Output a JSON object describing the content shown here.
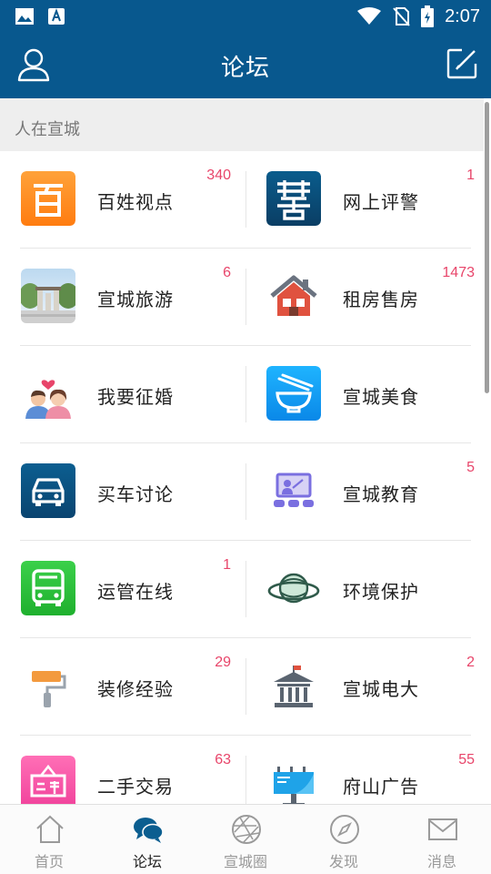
{
  "status_bar": {
    "time": "2:07",
    "icons": [
      "image-icon",
      "keyboard-a-icon",
      "wifi-icon",
      "no-sim-icon",
      "battery-icon"
    ]
  },
  "header": {
    "title": "论坛",
    "left_icon": "user-icon",
    "right_icon": "edit-icon"
  },
  "section": {
    "title": "人在宣城"
  },
  "forums": [
    {
      "left": {
        "label": "百姓视点",
        "count": "340",
        "icon": "baixing-icon"
      },
      "right": {
        "label": "网上评警",
        "count": "1",
        "icon": "police-icon"
      }
    },
    {
      "left": {
        "label": "宣城旅游",
        "count": "6",
        "icon": "travel-photo-icon"
      },
      "right": {
        "label": "租房售房",
        "count": "1473",
        "icon": "house-icon"
      }
    },
    {
      "left": {
        "label": "我要征婚",
        "count": "",
        "icon": "couple-icon"
      },
      "right": {
        "label": "宣城美食",
        "count": "",
        "icon": "bowl-icon"
      }
    },
    {
      "left": {
        "label": "买车讨论",
        "count": "",
        "icon": "car-icon"
      },
      "right": {
        "label": "宣城教育",
        "count": "5",
        "icon": "classroom-icon"
      }
    },
    {
      "left": {
        "label": "运管在线",
        "count": "1",
        "icon": "bus-icon"
      },
      "right": {
        "label": "环境保护",
        "count": "",
        "icon": "planet-icon"
      }
    },
    {
      "left": {
        "label": "装修经验",
        "count": "29",
        "icon": "paint-roller-icon"
      },
      "right": {
        "label": "宣城电大",
        "count": "2",
        "icon": "university-icon"
      }
    },
    {
      "left": {
        "label": "二手交易",
        "count": "63",
        "icon": "secondhand-sign-icon"
      },
      "right": {
        "label": "府山广告",
        "count": "55",
        "icon": "billboard-icon"
      }
    }
  ],
  "tabs": [
    {
      "label": "首页",
      "icon": "home-icon",
      "active": false
    },
    {
      "label": "论坛",
      "icon": "chat-bubbles-icon",
      "active": true
    },
    {
      "label": "宣城圈",
      "icon": "aperture-icon",
      "active": false
    },
    {
      "label": "发现",
      "icon": "compass-icon",
      "active": false
    },
    {
      "label": "消息",
      "icon": "mail-icon",
      "active": false
    }
  ],
  "colors": {
    "primary": "#08588e",
    "badge": "#e8456a"
  }
}
